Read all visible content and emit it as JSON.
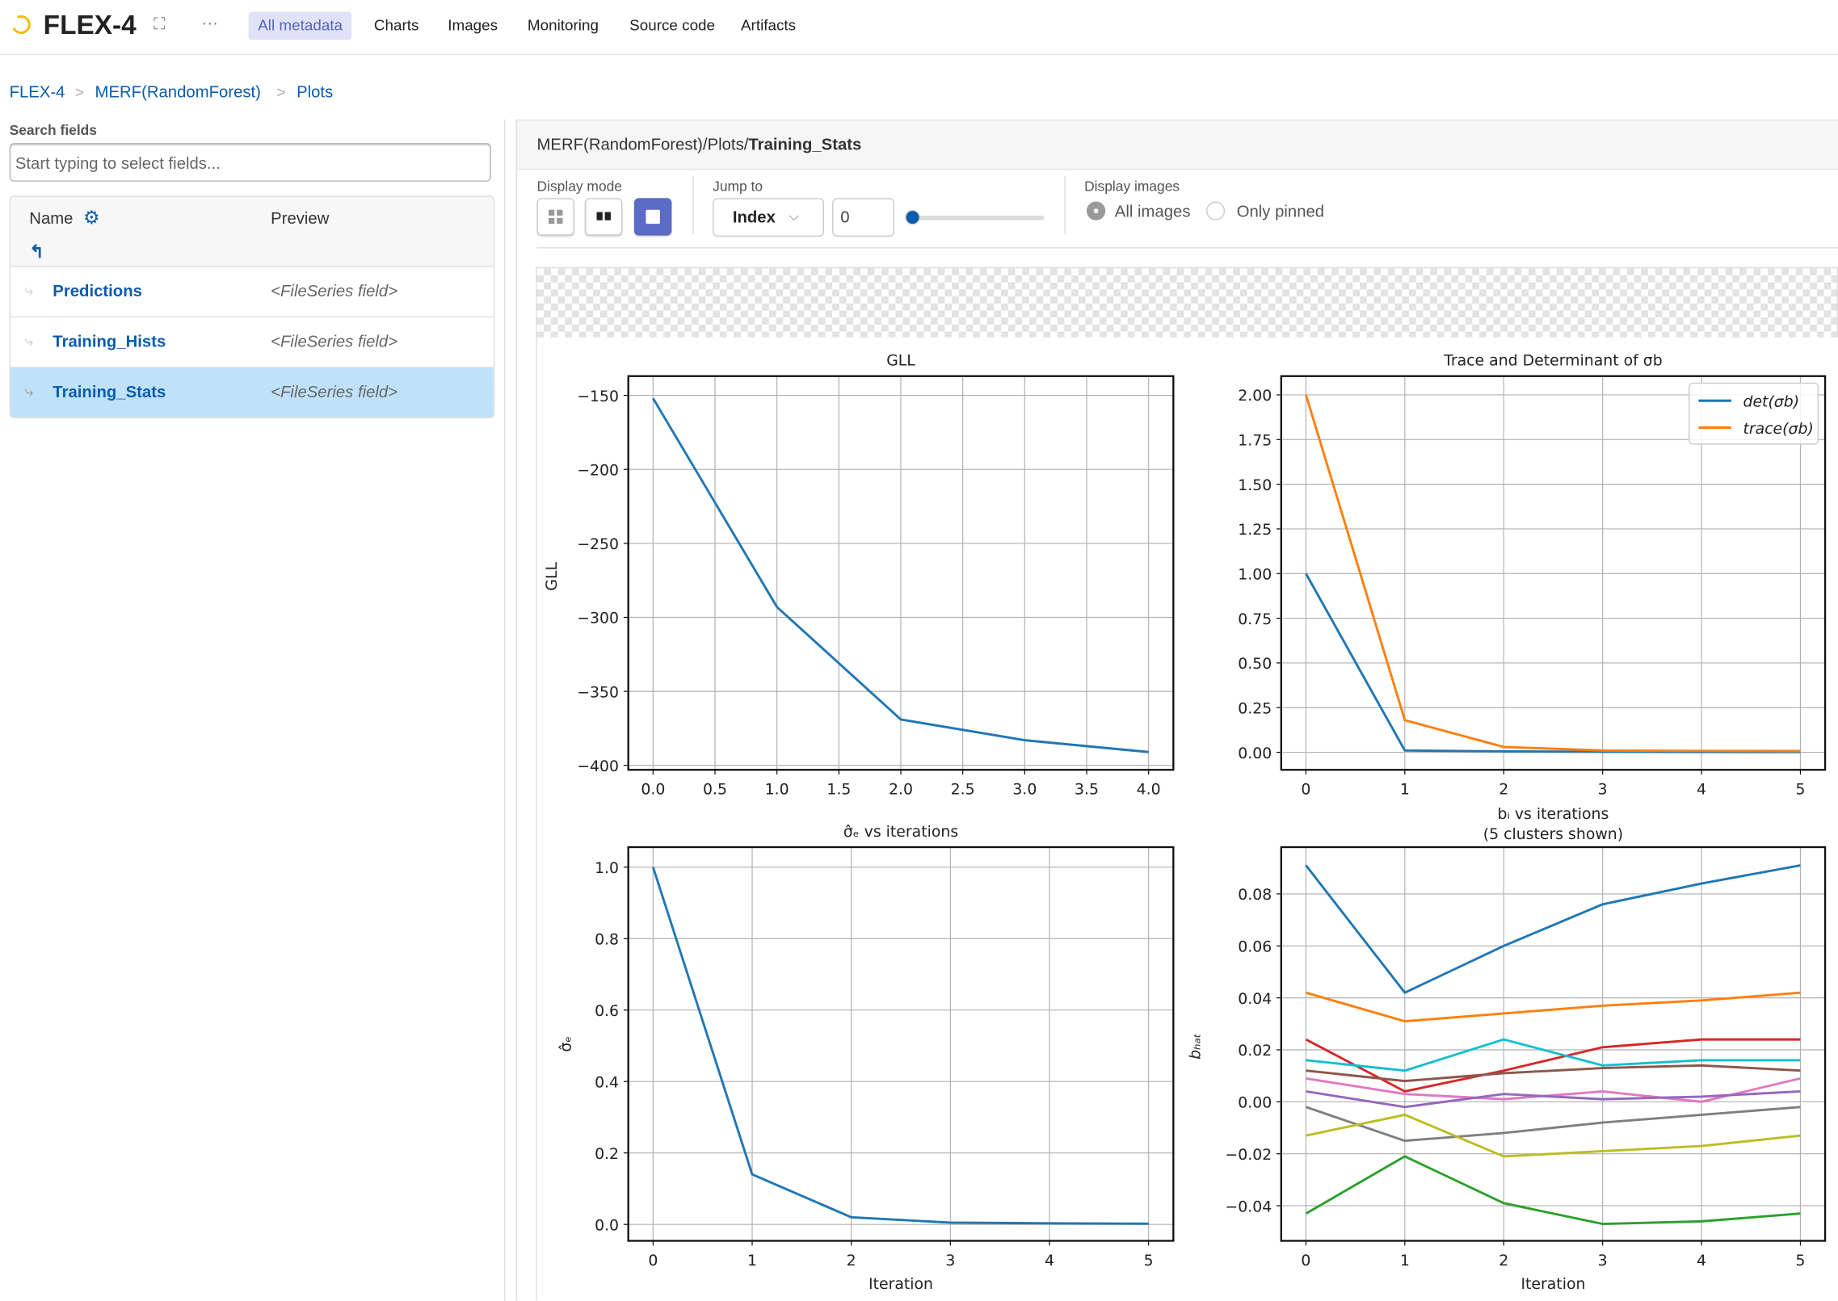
{
  "app": {
    "title": "FLEX-4"
  },
  "nav": {
    "tabs": [
      {
        "label": "All metadata",
        "active": true
      },
      {
        "label": "Charts"
      },
      {
        "label": "Images"
      },
      {
        "label": "Monitoring"
      },
      {
        "label": "Source code"
      },
      {
        "label": "Artifacts"
      }
    ]
  },
  "breadcrumb": [
    "FLEX-4",
    "MERF(RandomForest)",
    "Plots"
  ],
  "sidebar": {
    "search_label": "Search fields",
    "search_placeholder": "Start typing to select fields...",
    "col_name": "Name",
    "col_preview": "Preview",
    "rows": [
      {
        "name": "Predictions",
        "preview": "<FileSeries field>"
      },
      {
        "name": "Training_Hists",
        "preview": "<FileSeries field>"
      },
      {
        "name": "Training_Stats",
        "preview": "<FileSeries field>",
        "selected": true
      }
    ]
  },
  "viewer": {
    "path_prefix": "MERF(RandomForest)/Plots/",
    "path_leaf": "Training_Stats",
    "display_mode_label": "Display mode",
    "display_mode_selected": "single",
    "jump_to_label": "Jump to",
    "jump_mode": "Index",
    "jump_value": "0",
    "slider_value": 0,
    "display_images_label": "Display images",
    "opt_all": "All images",
    "opt_pinned": "Only pinned",
    "display_images_selected": "All images"
  },
  "colors": {
    "accent": "#5b6bc6",
    "link": "#0b5cad",
    "selected_row": "#bfe2fa",
    "logo": "#f5b800"
  },
  "chart_data": [
    {
      "type": "line",
      "title": "GLL",
      "xlabel": "",
      "ylabel": "GLL",
      "grid": true,
      "xlim": [
        -0.2,
        4.2
      ],
      "ylim": [
        -403,
        -137
      ],
      "xticks": [
        0,
        0.5,
        1,
        1.5,
        2,
        2.5,
        3,
        3.5,
        4
      ],
      "xticklabels": [
        "0.0",
        "0.5",
        "1.0",
        "1.5",
        "2.0",
        "2.5",
        "3.0",
        "3.5",
        "4.0"
      ],
      "yticks": [
        -150,
        -200,
        -250,
        -300,
        -350,
        -400
      ],
      "yticklabels": [
        "−150",
        "−200",
        "−250",
        "−300",
        "−350",
        "−400"
      ],
      "x": [
        0,
        1,
        2,
        3,
        4
      ],
      "series": [
        {
          "color": "#1f77b4",
          "values": [
            -152,
            -293,
            -369,
            -383,
            -391
          ]
        }
      ]
    },
    {
      "type": "line",
      "title": "Trace and Determinant of σb",
      "xlabel": "",
      "ylabel": "",
      "grid": true,
      "legend": "top-right",
      "xlim": [
        -0.25,
        5.25
      ],
      "ylim": [
        -0.098,
        2.105
      ],
      "xticks": [
        0,
        1,
        2,
        3,
        4,
        5
      ],
      "xticklabels": [
        "0",
        "1",
        "2",
        "3",
        "4",
        "5"
      ],
      "yticks": [
        0,
        0.25,
        0.5,
        0.75,
        1,
        1.25,
        1.5,
        1.75,
        2
      ],
      "yticklabels": [
        "0.00",
        "0.25",
        "0.50",
        "0.75",
        "1.00",
        "1.25",
        "1.50",
        "1.75",
        "2.00"
      ],
      "x": [
        0,
        1,
        2,
        3,
        4,
        5
      ],
      "series": [
        {
          "name": "det(σb)",
          "color": "#1f77b4",
          "values": [
            1.0,
            0.01,
            0.005,
            0.003,
            0.002,
            0.002
          ]
        },
        {
          "name": "trace(σb)",
          "color": "#ff7f0e",
          "values": [
            2.0,
            0.18,
            0.03,
            0.01,
            0.008,
            0.007
          ]
        }
      ]
    },
    {
      "type": "line",
      "title": "σ̂ₑ vs iterations",
      "xlabel": "Iteration",
      "ylabel": "σ̂ₑ",
      "grid": true,
      "xlim": [
        -0.25,
        5.25
      ],
      "ylim": [
        -0.046,
        1.056
      ],
      "xticks": [
        0,
        1,
        2,
        3,
        4,
        5
      ],
      "xticklabels": [
        "0",
        "1",
        "2",
        "3",
        "4",
        "5"
      ],
      "yticks": [
        0,
        0.2,
        0.4,
        0.6,
        0.8,
        1.0
      ],
      "yticklabels": [
        "0.0",
        "0.2",
        "0.4",
        "0.6",
        "0.8",
        "1.0"
      ],
      "x": [
        0,
        1,
        2,
        3,
        4,
        5
      ],
      "series": [
        {
          "color": "#1f77b4",
          "values": [
            1.0,
            0.14,
            0.02,
            0.005,
            0.003,
            0.002
          ]
        }
      ]
    },
    {
      "type": "line",
      "title": "bᵢ vs iterations",
      "subtitle": "(5 clusters shown)",
      "xlabel": "Iteration",
      "ylabel": "bₕₐₜ",
      "grid": true,
      "xlim": [
        -0.25,
        5.25
      ],
      "ylim": [
        -0.0535,
        0.098
      ],
      "xticks": [
        0,
        1,
        2,
        3,
        4,
        5
      ],
      "xticklabels": [
        "0",
        "1",
        "2",
        "3",
        "4",
        "5"
      ],
      "yticks": [
        -0.04,
        -0.02,
        0,
        0.02,
        0.04,
        0.06,
        0.08
      ],
      "yticklabels": [
        "−0.04",
        "−0.02",
        "0.00",
        "0.02",
        "0.04",
        "0.06",
        "0.08"
      ],
      "x": [
        0,
        1,
        2,
        3,
        4,
        5
      ],
      "series": [
        {
          "color": "#1f77b4",
          "values": [
            0.091,
            0.042,
            0.06,
            0.076,
            0.084,
            0.091
          ]
        },
        {
          "color": "#ff7f0e",
          "values": [
            0.042,
            0.031,
            0.034,
            0.037,
            0.039,
            0.042
          ]
        },
        {
          "color": "#d62728",
          "values": [
            0.024,
            0.004,
            0.012,
            0.021,
            0.024,
            0.024
          ]
        },
        {
          "color": "#17becf",
          "values": [
            0.016,
            0.012,
            0.024,
            0.014,
            0.016,
            0.016
          ]
        },
        {
          "color": "#8c564b",
          "values": [
            0.012,
            0.008,
            0.011,
            0.013,
            0.014,
            0.012
          ]
        },
        {
          "color": "#e377c2",
          "values": [
            0.009,
            0.003,
            0.001,
            0.004,
            0.0,
            0.009
          ]
        },
        {
          "color": "#9467bd",
          "values": [
            0.004,
            -0.002,
            0.003,
            0.001,
            0.002,
            0.004
          ]
        },
        {
          "color": "#7f7f7f",
          "values": [
            -0.002,
            -0.015,
            -0.012,
            -0.008,
            -0.005,
            -0.002
          ]
        },
        {
          "color": "#bcbd22",
          "values": [
            -0.013,
            -0.005,
            -0.021,
            -0.019,
            -0.017,
            -0.013
          ]
        },
        {
          "color": "#2ca02c",
          "values": [
            -0.043,
            -0.021,
            -0.039,
            -0.047,
            -0.046,
            -0.043
          ]
        }
      ]
    }
  ]
}
